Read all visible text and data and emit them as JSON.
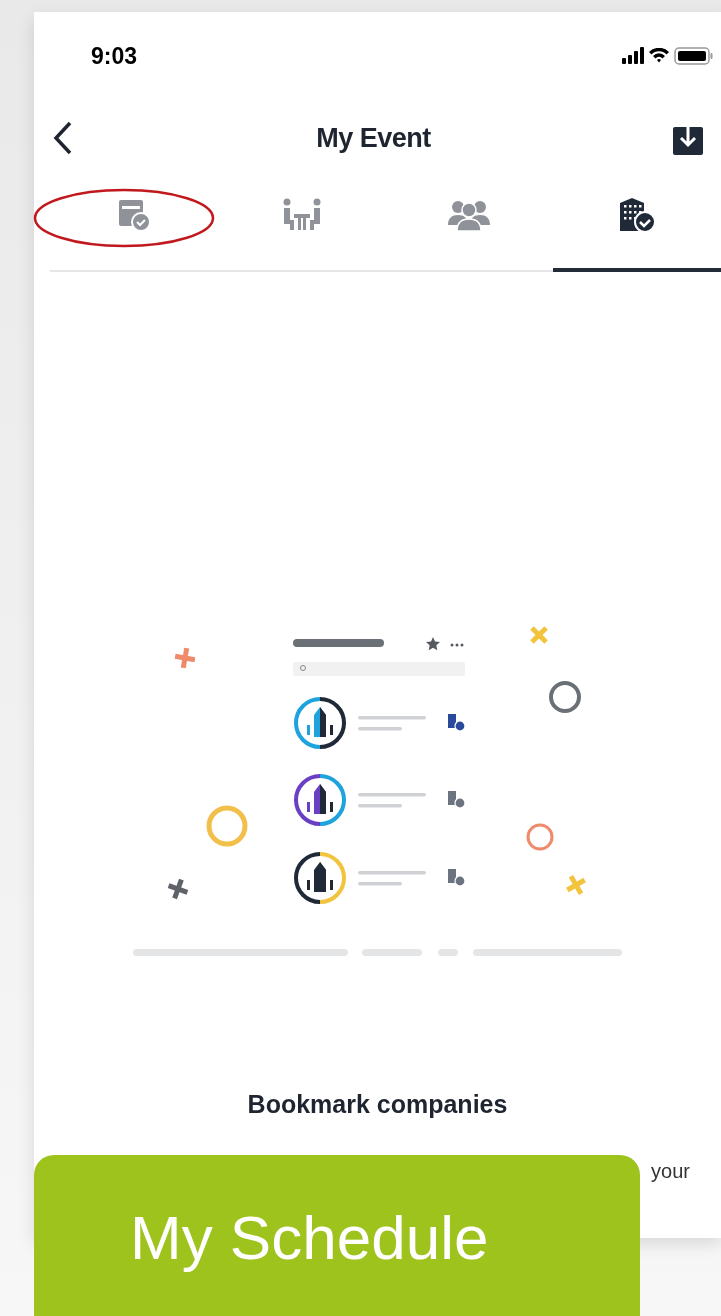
{
  "status_bar": {
    "time": "9:03"
  },
  "header": {
    "title": "My Event"
  },
  "tabs": [
    {
      "kind": "schedule",
      "selected": false,
      "circled": true
    },
    {
      "kind": "meetings",
      "selected": false,
      "circled": false
    },
    {
      "kind": "people",
      "selected": false,
      "circled": false
    },
    {
      "kind": "companies",
      "selected": true,
      "circled": false
    }
  ],
  "empty_state": {
    "title": "Bookmark companies",
    "description": "your"
  },
  "overlay_label": {
    "text": "My Schedule"
  }
}
